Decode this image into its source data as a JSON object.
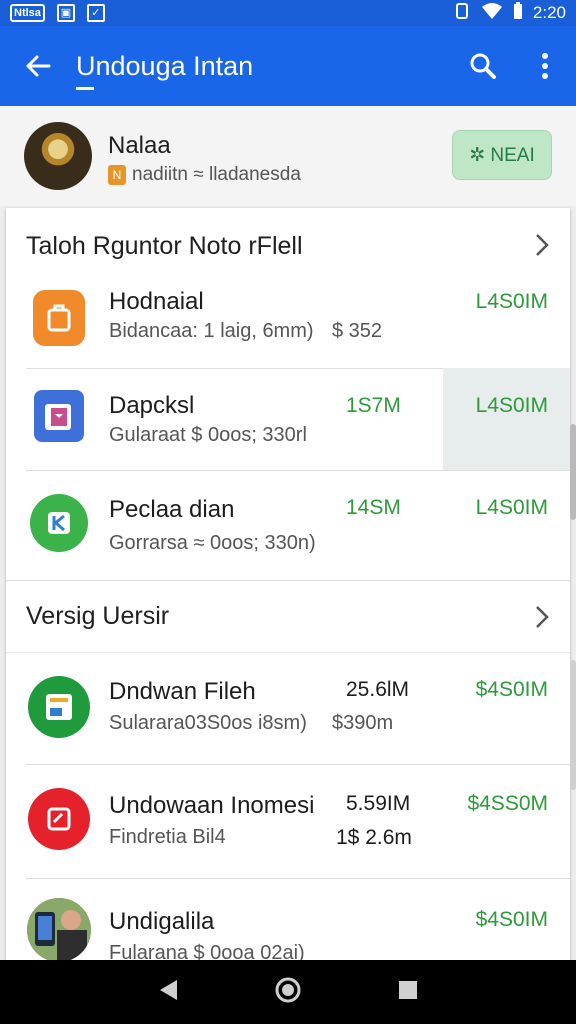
{
  "status_bar": {
    "badge_text": "Ntlsa",
    "time": "2:20"
  },
  "app_bar": {
    "title": "Undouga Intan"
  },
  "account": {
    "name": "Nalaa",
    "subtitle": "nadiitn ≈ lladanesda",
    "new_button": "✲ NEAI"
  },
  "sections": [
    {
      "title": "Taloh Rguntor Noto rFlell",
      "apps": [
        {
          "name": "Hodnaial",
          "meta": "Bidancaa: 1 laig, 6mm)",
          "meta2": "$ 352",
          "size": "",
          "price": "L4S0IM"
        },
        {
          "name": "Dapcksl",
          "meta": "Gularaat $ 0oos; 330rl",
          "meta2": "",
          "size": "1S7M",
          "price": "L4S0IM"
        },
        {
          "name": "Peclaa dian",
          "meta": "Gorrarsa ≈ 0oos; 330n)",
          "meta2": "",
          "size": "14SM",
          "price": "L4S0IM"
        }
      ]
    },
    {
      "title": "Versig Uersir",
      "apps": [
        {
          "name": "Dndwan Fileh",
          "meta": "Sularara03S0os i8sm)",
          "meta2": "$390m",
          "size": "25.6lM",
          "price": "$4S0IM"
        },
        {
          "name": "Undowaan Inomesi",
          "meta": "Findretia Bil4",
          "meta2": "",
          "size": "5.59IM",
          "size2": "1$ 2.6m",
          "price": "$4SS0M"
        },
        {
          "name": "Undigalila",
          "meta": "Fularana $ 0ooa 02ai)",
          "meta2": "",
          "size": "",
          "price": "$4S0IM"
        }
      ]
    }
  ],
  "colors": {
    "app_bar": "#1a66e8",
    "status_bar": "#1a5fd8",
    "price_green": "#2e9a3a",
    "new_button_bg": "#bfe6c7"
  },
  "icons": {
    "back": "arrow-back-icon",
    "search": "search-icon",
    "more": "more-vert-icon",
    "chevron": "chevron-right-icon",
    "nav_back": "nav-back-icon",
    "nav_home": "nav-home-icon",
    "nav_recents": "nav-recents-icon"
  }
}
